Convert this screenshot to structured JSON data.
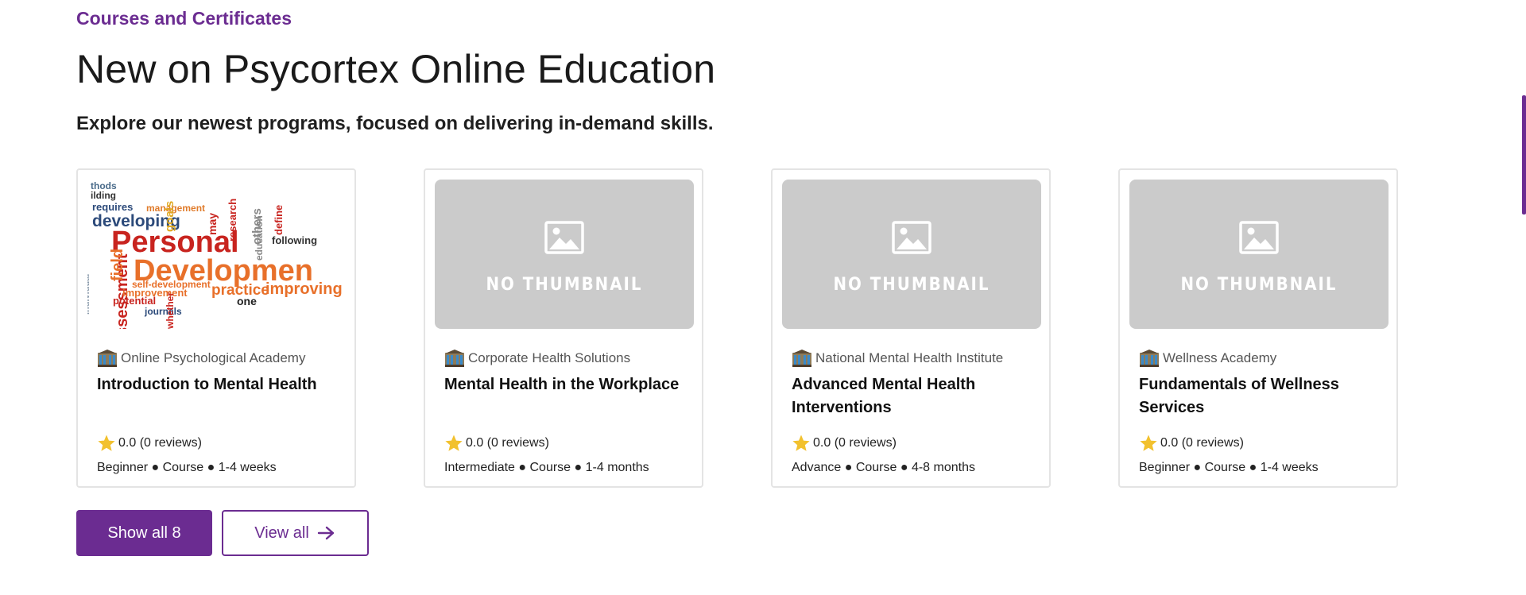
{
  "section": {
    "eyebrow": "Courses and Certificates",
    "title": "New on Psycortex Online Education",
    "subtitle": "Explore our newest programs, focused on delivering in-demand skills."
  },
  "thumbnail_placeholder": "NO THUMBNAIL",
  "thumbnail_words": [
    "thods",
    "ilding",
    "requires",
    "management",
    "developing",
    "Personal",
    "Developmen",
    "assessment",
    "field",
    "self-development",
    "practice",
    "improving",
    "potential",
    "improvement",
    "journals",
    "research",
    "others",
    "education",
    "goals",
    "may",
    "following",
    "define",
    "one",
    "whether",
    "individual"
  ],
  "courses": [
    {
      "provider": "Online Psychological Academy",
      "title": "Introduction to Mental Health",
      "rating": "0.0 (0 reviews)",
      "meta": "Beginner ● Course ● 1-4 weeks",
      "thumbnail": "word-cloud"
    },
    {
      "provider": "Corporate Health Solutions",
      "title": "Mental Health in the Workplace",
      "rating": "0.0 (0 reviews)",
      "meta": "Intermediate ● Course ● 1-4 months",
      "thumbnail": "none"
    },
    {
      "provider": "National Mental Health Institute",
      "title": "Advanced Mental Health Interventions",
      "rating": "0.0 (0 reviews)",
      "meta": "Advance ● Course ● 4-8 months",
      "thumbnail": "none"
    },
    {
      "provider": "Wellness Academy",
      "title": "Fundamentals of Wellness Services",
      "rating": "0.0 (0 reviews)",
      "meta": "Beginner ● Course ● 1-4 weeks",
      "thumbnail": "none"
    }
  ],
  "buttons": {
    "show_all": "Show all 8",
    "view_all": "View all"
  },
  "icons": {
    "provider": "institution-icon",
    "rating": "star-icon",
    "placeholder": "image-icon",
    "view_all": "arrow-right-icon"
  },
  "colors": {
    "brand": "#6b2c91",
    "star": "#f2c12e",
    "placeholder_bg": "#cbcbcb",
    "card_border": "#e4e4e4"
  }
}
